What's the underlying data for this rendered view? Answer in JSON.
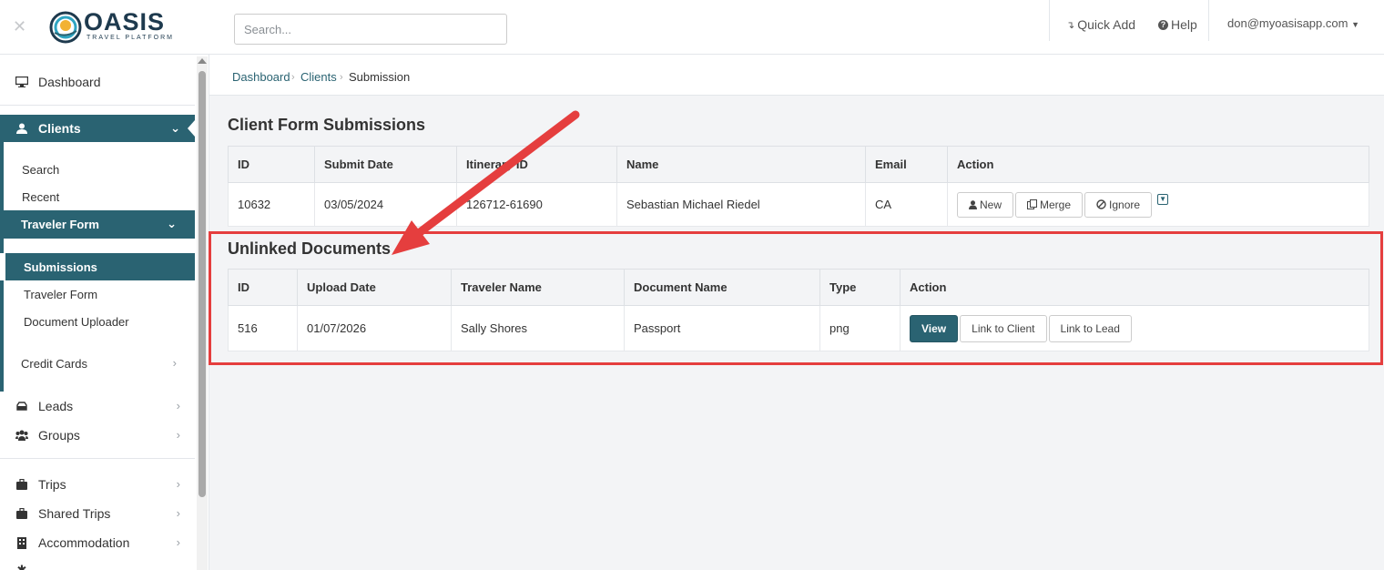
{
  "topbar": {
    "search_placeholder": "Search...",
    "quick_add": "Quick Add",
    "help": "Help",
    "user_email": "don@myoasisapp.com",
    "logo_name": "OASIS",
    "logo_sub": "TRAVEL PLATFORM"
  },
  "sidebar": {
    "dashboard": "Dashboard",
    "clients": "Clients",
    "clients_sub": {
      "search": "Search",
      "recent": "Recent",
      "traveler_form": "Traveler Form",
      "traveler_form_sub": {
        "submissions": "Submissions",
        "traveler_form": "Traveler Form",
        "document_uploader": "Document Uploader"
      },
      "credit_cards": "Credit Cards"
    },
    "leads": "Leads",
    "groups": "Groups",
    "trips": "Trips",
    "shared_trips": "Shared Trips",
    "accommodation": "Accommodation"
  },
  "breadcrumb": {
    "items": [
      "Dashboard",
      "Clients"
    ],
    "current": "Submission"
  },
  "client_form_submissions": {
    "title": "Client Form Submissions",
    "columns": [
      "ID",
      "Submit Date",
      "Itinerary ID",
      "Name",
      "Email",
      "Action"
    ],
    "rows": [
      {
        "id": "10632",
        "submit_date": "03/05/2024",
        "itinerary_id": "126712-61690",
        "name": "Sebastian Michael Riedel",
        "email": "CA"
      }
    ],
    "actions": {
      "new": "New",
      "merge": "Merge",
      "ignore": "Ignore"
    }
  },
  "unlinked_documents": {
    "title": "Unlinked Documents",
    "columns": [
      "ID",
      "Upload Date",
      "Traveler Name",
      "Document Name",
      "Type",
      "Action"
    ],
    "rows": [
      {
        "id": "516",
        "upload_date": "01/07/2026",
        "traveler_name": "Sally Shores",
        "document_name": "Passport",
        "type": "png"
      }
    ],
    "actions": {
      "view": "View",
      "link_client": "Link to Client",
      "link_lead": "Link to Lead"
    }
  },
  "colors": {
    "accent": "#2a6372",
    "annotation": "#e53e3e"
  }
}
